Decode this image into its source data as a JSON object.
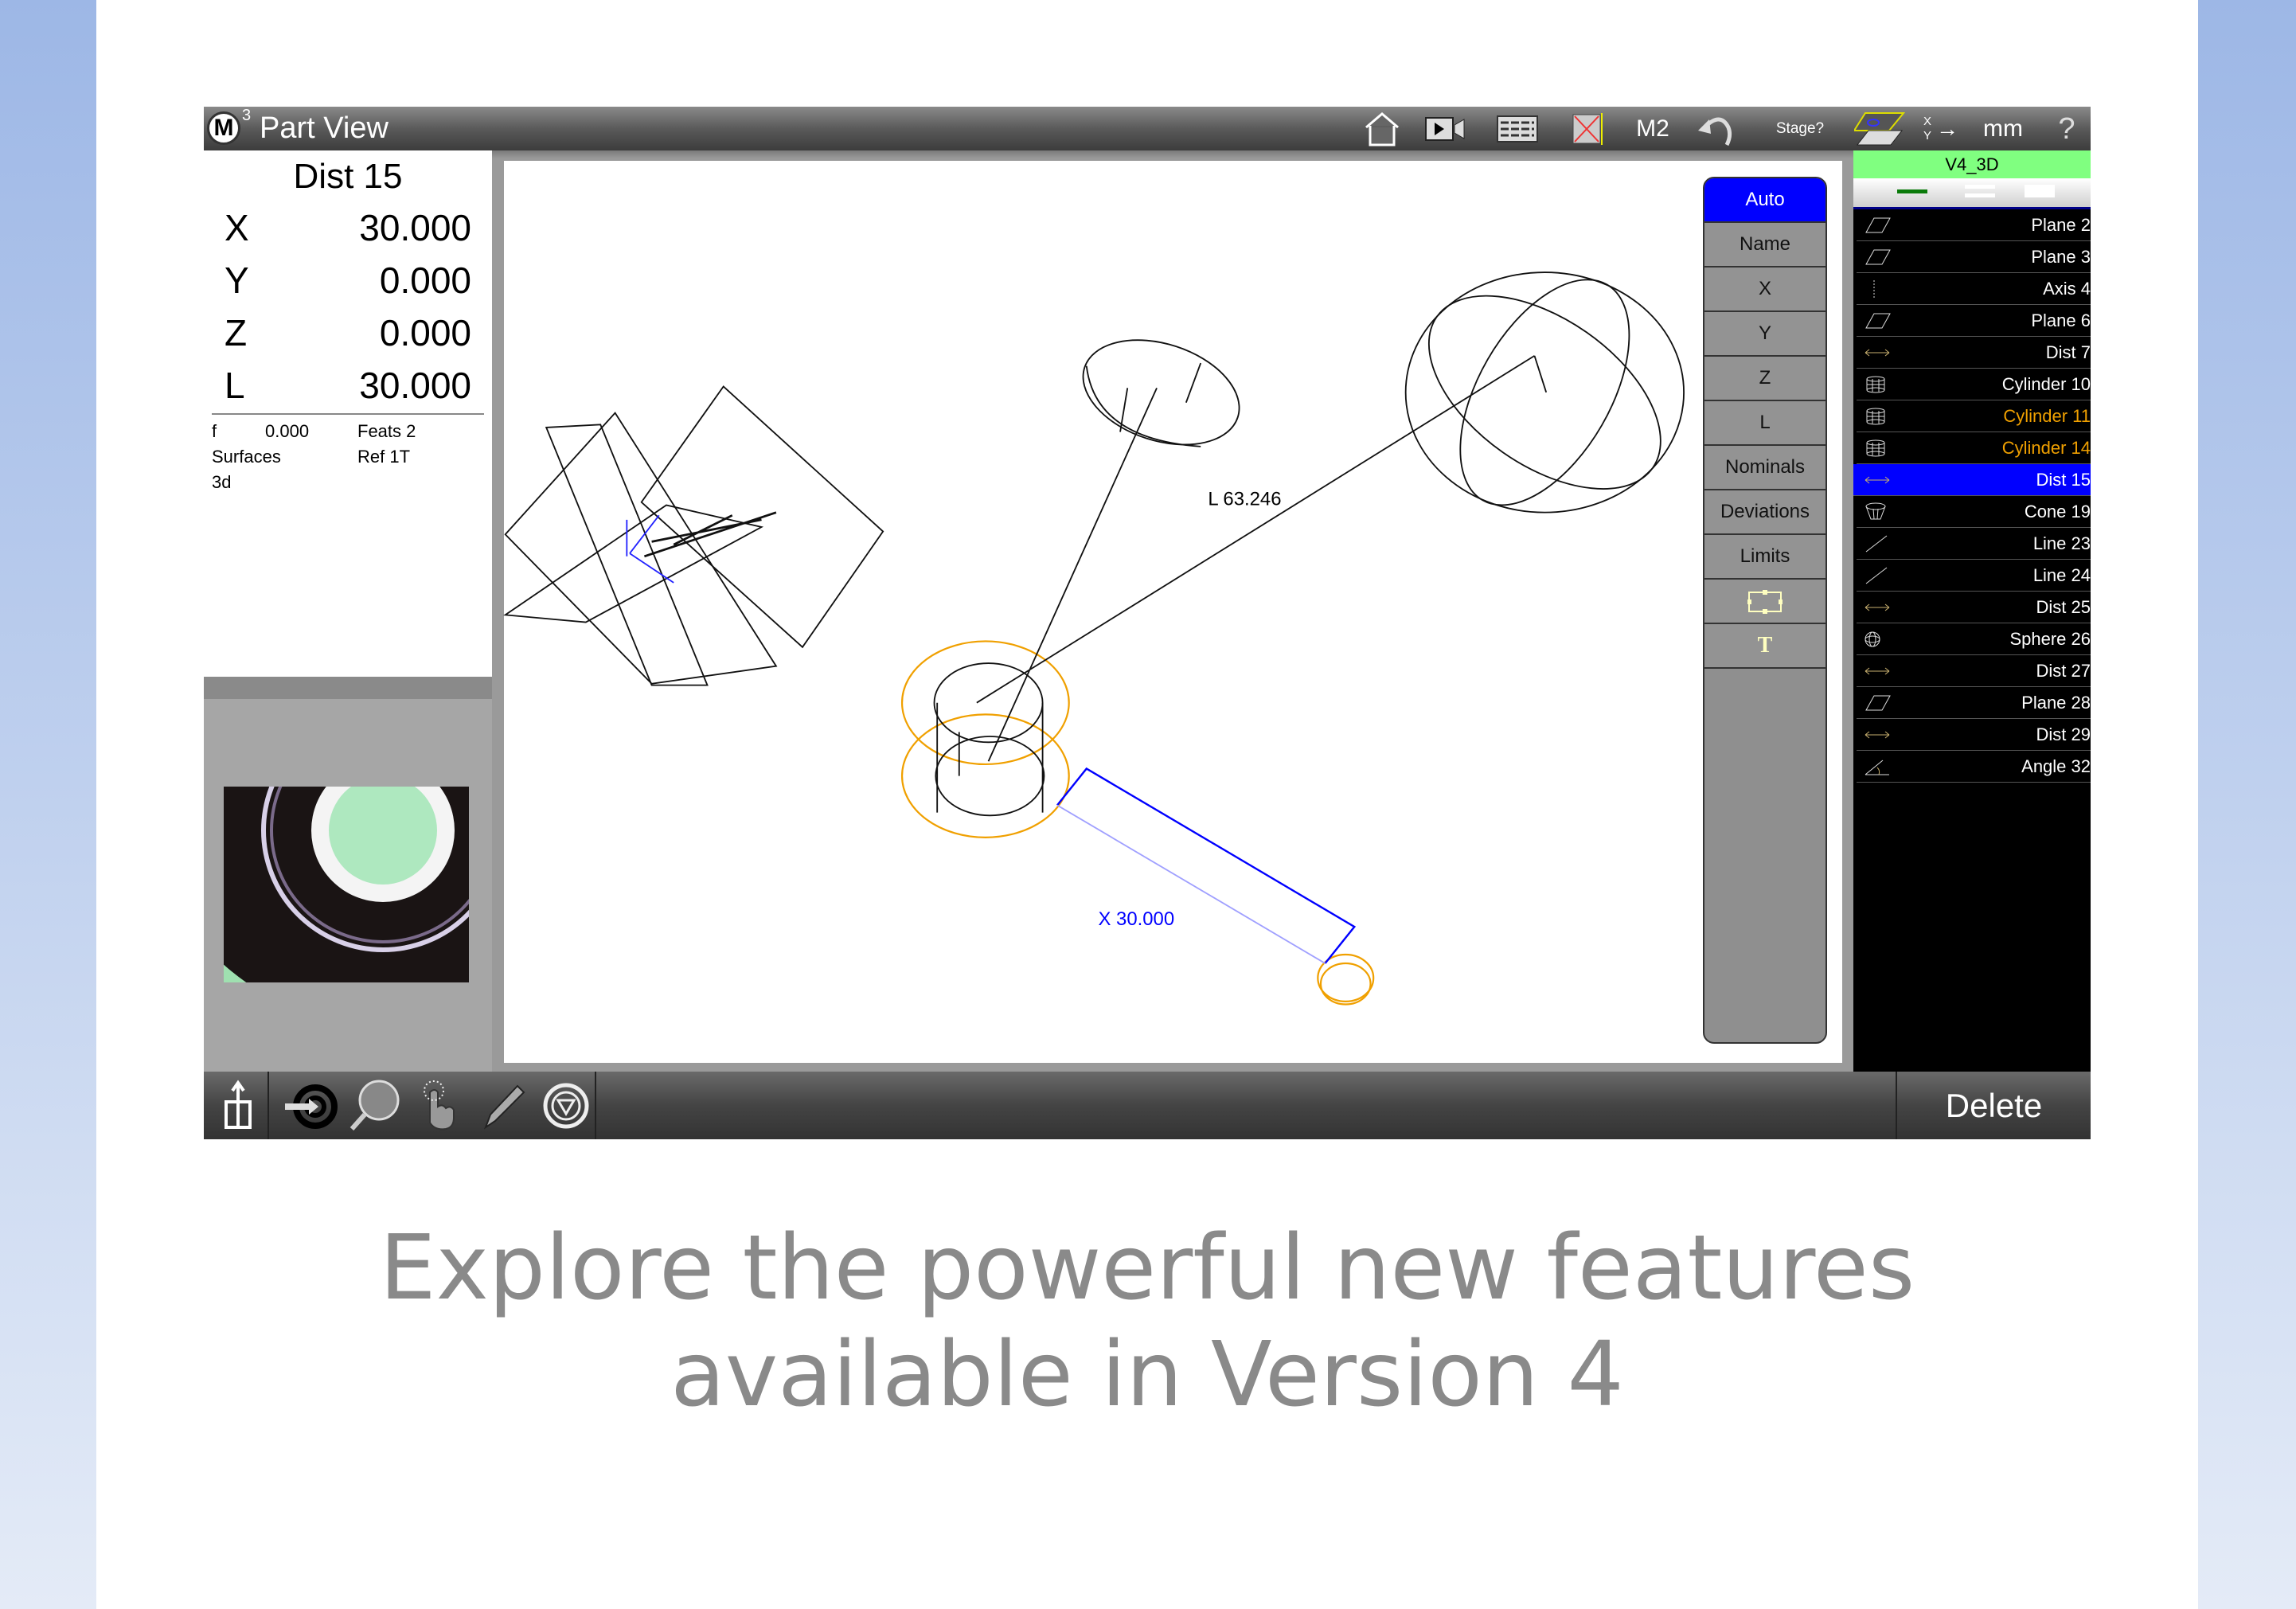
{
  "app": {
    "logo": "M",
    "logo_sup": "3",
    "title": "Part View"
  },
  "toolbar": {
    "m2": "M2",
    "stage": "Stage?",
    "axis_x": "X",
    "axis_y": "Y",
    "units": "mm",
    "help": "?",
    "icons": [
      "home-icon",
      "video-icon",
      "table-icon",
      "camera-off-icon",
      "undo-icon",
      "stage-icon"
    ]
  },
  "feature": {
    "name": "Dist 15",
    "rows": [
      {
        "label": "X",
        "value": "30.000"
      },
      {
        "label": "Y",
        "value": "0.000"
      },
      {
        "label": "Z",
        "value": "0.000"
      },
      {
        "label": "L",
        "value": "30.000"
      }
    ],
    "info": {
      "f_label": "f",
      "f_value": "0.000",
      "feats": "Feats 2",
      "surfaces": "Surfaces",
      "ref": "Ref 1T",
      "mode": "3d"
    }
  },
  "canvas": {
    "length_label": "L  63.246",
    "x_label": "X  30.000",
    "colors": {
      "selected": "#0000ff",
      "highlight": "#f0a000"
    }
  },
  "side_buttons": [
    "Auto",
    "Name",
    "X",
    "Y",
    "Z",
    "L",
    "Nominals",
    "Deviations",
    "Limits"
  ],
  "side_icons": {
    "frame": "frame-icon",
    "text": "T"
  },
  "feature_list": {
    "header": "V4_3D",
    "items": [
      {
        "label": "Plane 2",
        "icon": "plane"
      },
      {
        "label": "Plane 3",
        "icon": "plane"
      },
      {
        "label": "Axis 4",
        "icon": "axis"
      },
      {
        "label": "Plane 6",
        "icon": "plane"
      },
      {
        "label": "Dist 7",
        "icon": "dist"
      },
      {
        "label": "Cylinder 10",
        "icon": "cylinder"
      },
      {
        "label": "Cylinder 11",
        "icon": "cylinder",
        "state": "highlight"
      },
      {
        "label": "Cylinder 14",
        "icon": "cylinder",
        "state": "highlight"
      },
      {
        "label": "Dist 15",
        "icon": "dist",
        "state": "selected"
      },
      {
        "label": "Cone 19",
        "icon": "cone"
      },
      {
        "label": "Line 23",
        "icon": "line"
      },
      {
        "label": "Line 24",
        "icon": "line"
      },
      {
        "label": "Dist 25",
        "icon": "dist"
      },
      {
        "label": "Sphere 26",
        "icon": "sphere"
      },
      {
        "label": "Dist 27",
        "icon": "dist"
      },
      {
        "label": "Plane 28",
        "icon": "plane"
      },
      {
        "label": "Dist 29",
        "icon": "dist"
      },
      {
        "label": "Angle 32",
        "icon": "angle"
      }
    ]
  },
  "bottom": {
    "delete": "Delete",
    "icons": [
      "export-icon",
      "target-icon",
      "magnifier-icon",
      "touch-icon",
      "pencil-icon",
      "filter-icon"
    ]
  },
  "caption": {
    "line1": "Explore the powerful new features",
    "line2": "available in Version 4"
  }
}
